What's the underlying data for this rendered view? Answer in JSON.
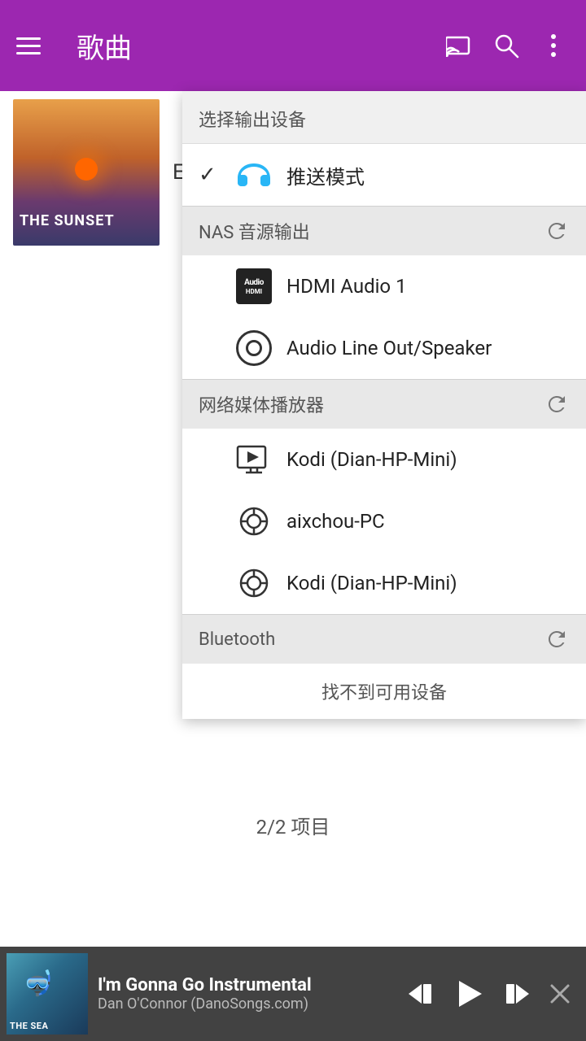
{
  "header": {
    "title": "歌曲",
    "menu_label": "menu",
    "cast_label": "cast",
    "search_label": "search",
    "more_label": "more"
  },
  "songs": [
    {
      "id": 1,
      "title": "En la Brisa",
      "thumb_label": "THE SUNSET"
    }
  ],
  "dropdown": {
    "title": "选择输出设备",
    "push_mode_label": "推送模式",
    "nas_section_label": "NAS 音源输出",
    "nas_devices": [
      {
        "id": "hdmi1",
        "label": "HDMI Audio 1"
      },
      {
        "id": "lineout",
        "label": "Audio Line Out/Speaker"
      }
    ],
    "network_section_label": "网络媒体播放器",
    "network_devices": [
      {
        "id": "kodi1",
        "label": "Kodi (Dian-HP-Mini)"
      },
      {
        "id": "aixchou",
        "label": "aixchou-PC"
      },
      {
        "id": "kodi2",
        "label": "Kodi (Dian-HP-Mini)"
      }
    ],
    "bluetooth_section_label": "Bluetooth",
    "bluetooth_no_device": "找不到可用设备"
  },
  "status_bar": {
    "text": "2/2 项目"
  },
  "player": {
    "thumb_label": "THE SEA",
    "title": "I'm Gonna Go Instrumental",
    "artist": "Dan O'Connor (DanoSongs.com)",
    "prev_label": "previous",
    "play_label": "play",
    "next_label": "next",
    "close_label": "close"
  }
}
